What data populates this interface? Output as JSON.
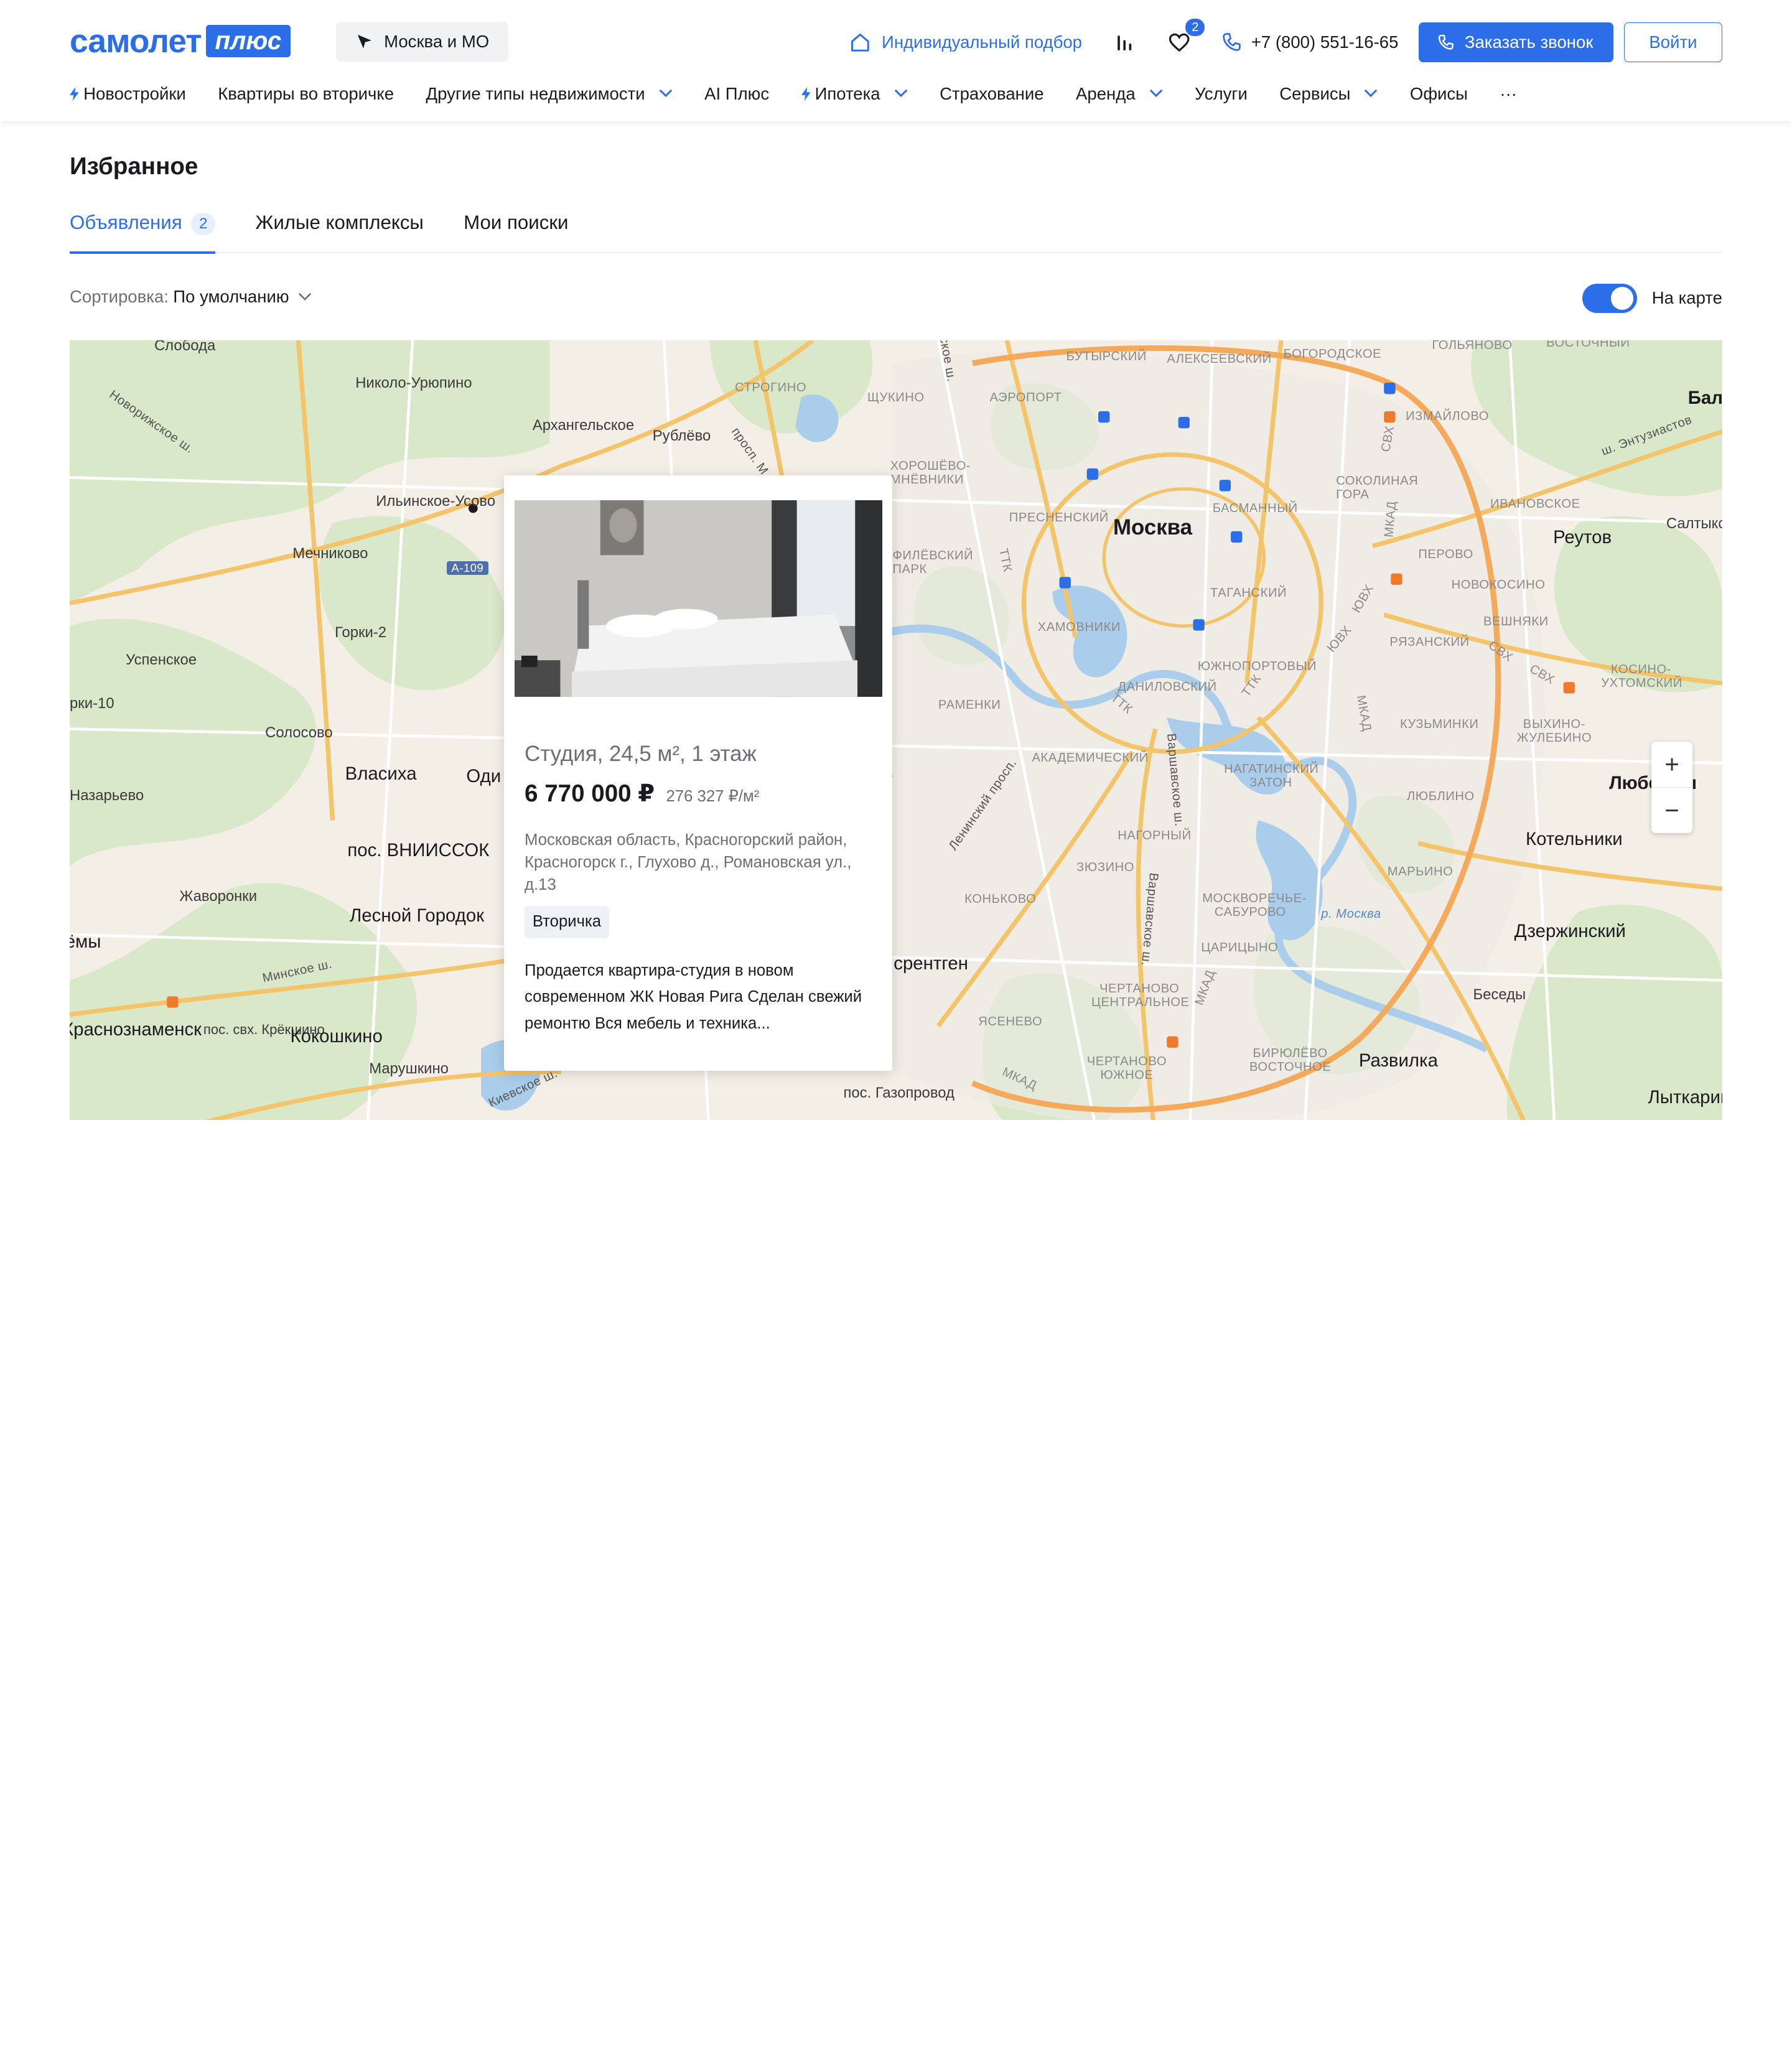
{
  "brand": {
    "word": "самолет",
    "plus": "плюс",
    "color": "#2c6ee8"
  },
  "region": {
    "label": "Москва и МО",
    "icon": "location-arrow-icon"
  },
  "header": {
    "individual_selection": "Индивидуальный подбор",
    "favorites_count": "2",
    "phone": "+7 (800) 551-16-65",
    "callback_button": "Заказать звонок",
    "login_button": "Войти"
  },
  "nav": {
    "items": [
      {
        "label": "Новостройки",
        "bolt": true,
        "dropdown": false
      },
      {
        "label": "Квартиры во вторичке",
        "bolt": false,
        "dropdown": false
      },
      {
        "label": "Другие типы недвижимости",
        "bolt": false,
        "dropdown": true
      },
      {
        "label": "AI Плюс",
        "bolt": false,
        "dropdown": false
      },
      {
        "label": "Ипотека",
        "bolt": true,
        "dropdown": true
      },
      {
        "label": "Страхование",
        "bolt": false,
        "dropdown": false
      },
      {
        "label": "Аренда",
        "bolt": false,
        "dropdown": true
      },
      {
        "label": "Услуги",
        "bolt": false,
        "dropdown": false
      },
      {
        "label": "Сервисы",
        "bolt": false,
        "dropdown": true
      },
      {
        "label": "Офисы",
        "bolt": false,
        "dropdown": false
      }
    ],
    "more": "···"
  },
  "page": {
    "title": "Избранное",
    "tabs": [
      {
        "label": "Объявления",
        "count": "2",
        "active": true
      },
      {
        "label": "Жилые комплексы",
        "active": false
      },
      {
        "label": "Мои поиски",
        "active": false
      }
    ],
    "sort_label": "Сортировка:",
    "sort_value": "По умолчанию",
    "map_toggle_label": "На карте",
    "map_toggle_on": true
  },
  "map": {
    "zoom_in": "+",
    "zoom_out": "−",
    "labels": {
      "sloboda": "Слобода",
      "nikolo": "Николо-Урюпино",
      "arkh": "Архангельское",
      "rublevo": "Рублёво",
      "ilinskoe": "Ильинское-Усово",
      "mechnikovo": "Мечниково",
      "gorki": "Горки-2",
      "uspenskoe": "Успенское",
      "solosovo": "Солосово",
      "vlasikha": "Власиха",
      "nazarevo": "Назарьево",
      "vniissok": "пос. ВНИИССОК",
      "zhavoronki": "Жаворонки",
      "lesnoy": "Лесной Городок",
      "krasnoznamensk": "Краснознаменск",
      "krekshino": "пос. свх. Крёкшино",
      "kokoshkino": "Кокошкино",
      "marushkino": "Марушкино",
      "moskva": "Москва",
      "reutov": "Реутов",
      "lyubertsy": "Люберцы",
      "kotelniki": "Котельники",
      "dzerzhinsky": "Дзержинский",
      "razvilka": "Развилка",
      "beseda": "Беседы",
      "lytkarino": "Лыткарин",
      "saltykovka": "Салтыко",
      "bal": "Бал",
      "gazoprovod": "пос. Газопровод",
      "butyrsky": "БУТЫРСКИЙ",
      "alekseevsky": "АЛЕКСЕЕВСКИЙ",
      "bogorodskoe": "БОГОРОДСКОЕ",
      "golyanovo": "ГОЛЬЯНОВО",
      "vostochny": "ВОСТОЧНЫЙ",
      "shchukino": "ЩУКИНО",
      "aeroport": "АЭРОПОРТ",
      "izmaylovo": "ИЗМАЙЛОВО",
      "strogino": "СТРОГИНО",
      "khoroshevo": "ХОРОШЁВО-МНЁВНИКИ",
      "sokolnicheskaya": "СОКОЛИНАЯ ГОРА",
      "ivanovskoe": "ИВАНОВСКОЕ",
      "basmanny": "БАСМАННЫЙ",
      "presnensky": "ПРЕСНЕНСКИЙ",
      "perovo": "ПЕРОВО",
      "filevsky": "ФИЛЁВСКИЙ ПАРК",
      "tagansky": "ТАГАНСКИЙ",
      "novokosino": "НОВОКОСИНО",
      "khamovniki": "ХАМОВНИКИ",
      "veshnyaki": "ВЕШНЯКИ",
      "ryazansky": "РЯЗАНСКИЙ",
      "yuzhnoport": "ЮЖНОПОРТОВЫЙ",
      "kosino": "КОСИНО- УХТОМСКИЙ",
      "danilovsky": "ДАНИЛОВСКИЙ",
      "kuzminki": "КУЗЬМИНКИ",
      "vykhino": "ВЫХИНО- ЖУЛЕБИНО",
      "ramenki": "РАМЕНКИ",
      "akademichesky": "АКАДЕМИЧЕСКИЙ",
      "nagatinsky": "НАГАТИНСКИЙ ЗАТОН",
      "lyublino": "ЛЮБЛИНО",
      "nagorny": "НАГОРНЫЙ",
      "zyuzino": "ЗЮЗИНО",
      "marino": "МАРЬИНО",
      "konkovo": "КОНЬКОВО",
      "moskvorechye": "МОСКВОРЕЧЬЕ- САБУРОВО",
      "tsaritsyno": "ЦАРИЦЫНО",
      "chertanovo": "ЧЕРТАНОВО ЦЕНТРАЛЬНОЕ",
      "yasenevo": "ЯСЕНЕВО",
      "chertanovo_s": "ЧЕРТАНОВО ЮЖНОЕ",
      "biryulevo": "БИРЮЛЁВО ВОСТОЧНОЕ",
      "rentgen": "срентген",
      "yomy": "ёмы",
      "ki10": "рки-10",
      "odi": "Оди",
      "a109": "А-109",
      "ttk1": "ТТК",
      "ttk2": "ТТК",
      "ttk3": "ТТК",
      "svkh1": "СВХ",
      "svkh2": "СВХ",
      "svkh3": "СВХ",
      "yuvkh1": "ЮВХ",
      "yuvkh2": "ЮВХ",
      "mkad1": "МКАД",
      "mkad2": "МКАД",
      "mkad3": "МКАД",
      "mkad4": "МКАД",
      "r_moskva": "р. Москва",
      "leninsky": "Ленинский просп.",
      "varshavskoe1": "Варшавское ш.",
      "varshavskoe2": "Варшавское ш.",
      "novorizhskoe": "Новорижское ш.",
      "minskoe": "Минское ш.",
      "kievskoe": "Киевское ш.",
      "entuziastov": "ш. Энтузиастов",
      "prosp_m": "просп. М",
      "skoe_sh": "ское ш."
    }
  },
  "listing": {
    "title": "Студия, 24,5 м², 1 этаж",
    "price": "6 770 000 ₽",
    "price_per_m2": "276 327 ₽/м²",
    "address": "Московская область, Красногорский район, Красногорск г., Глухово д., Романовская ул., д.13",
    "tag": "Вторичка",
    "description": "Продается квартира-студия в новом современном ЖК Новая Рига Сделан свежий ремонтю Вся мебель и техника..."
  }
}
